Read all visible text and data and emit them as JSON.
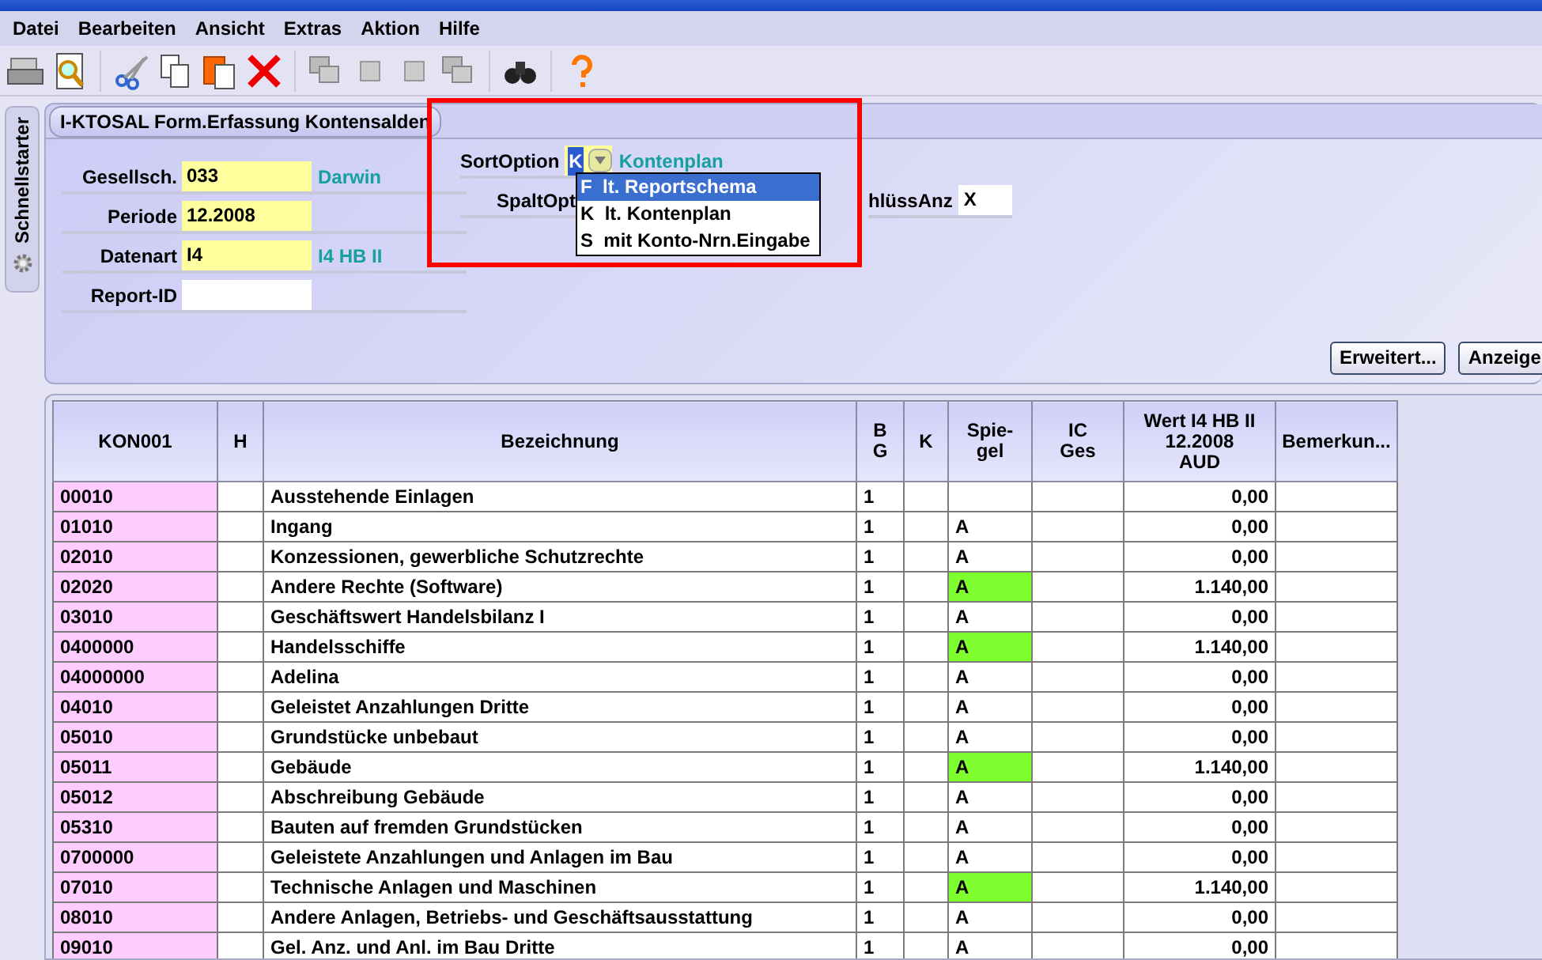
{
  "menu": [
    "Datei",
    "Bearbeiten",
    "Ansicht",
    "Extras",
    "Aktion",
    "Hilfe"
  ],
  "sidebar_tab": "Schnellstarter",
  "form_tab": "I-KTOSAL Form.Erfassung Kontensalden",
  "fields": [
    {
      "label": "Gesellsch.",
      "value": "033",
      "required": true,
      "info": "Darwin"
    },
    {
      "label": "Periode",
      "value": "12.2008",
      "required": true
    },
    {
      "label": "Datenart",
      "value": "I4",
      "required": true,
      "info": "I4 HB II"
    },
    {
      "label": "Report-ID",
      "required": false
    }
  ],
  "sort_option": {
    "label": "SortOption",
    "value": "K",
    "info": "Kontenplan"
  },
  "spalt_opt": {
    "label": "SpaltOpt"
  },
  "schluess_anz": {
    "label": "hlüssAnz",
    "value": "X"
  },
  "dropdown": [
    {
      "code": "F",
      "label": "lt. Reportschema",
      "selected": true
    },
    {
      "code": "K",
      "label": "lt. Kontenplan",
      "selected": false
    },
    {
      "code": "S",
      "label": "mit Konto-Nrn.Eingabe",
      "selected": false
    }
  ],
  "buttons": [
    "Erweitert...",
    "Anzeige"
  ],
  "table": {
    "columns": [
      "KON001",
      "H",
      "Bezeichnung",
      "B\nG",
      "K",
      "Spie-\ngel",
      "IC\nGes",
      "Wert I4 HB II\n12.2008\nAUD",
      "Bemerkun..."
    ],
    "rows": [
      {
        "code": "00010",
        "name": "Ausstehende Einlagen",
        "bg": "1",
        "wert": "0,00",
        "highlighted": false
      },
      {
        "code": "01010",
        "name": "Ingang",
        "bg": "1",
        "spiegel": "A",
        "wert": "0,00",
        "highlighted": false
      },
      {
        "code": "02010",
        "name": "Konzessionen, gewerbliche Schutzrechte",
        "bg": "1",
        "spiegel": "A",
        "wert": "0,00",
        "highlighted": false
      },
      {
        "code": "02020",
        "name": "Andere Rechte (Software)",
        "bg": "1",
        "spiegel": "A",
        "wert": "1.140,00",
        "highlighted": true
      },
      {
        "code": "03010",
        "name": "Geschäftswert Handelsbilanz I",
        "bg": "1",
        "spiegel": "A",
        "wert": "0,00",
        "highlighted": false
      },
      {
        "code": "0400000",
        "name": "Handelsschiffe",
        "bg": "1",
        "spiegel": "A",
        "wert": "1.140,00",
        "highlighted": true
      },
      {
        "code": "04000000",
        "name": "Adelina",
        "bg": "1",
        "spiegel": "A",
        "wert": "0,00",
        "highlighted": false
      },
      {
        "code": "04010",
        "name": "Geleistet Anzahlungen Dritte",
        "bg": "1",
        "spiegel": "A",
        "wert": "0,00",
        "highlighted": false
      },
      {
        "code": "05010",
        "name": "Grundstücke unbebaut",
        "bg": "1",
        "spiegel": "A",
        "wert": "0,00",
        "highlighted": false
      },
      {
        "code": "05011",
        "name": "Gebäude",
        "bg": "1",
        "spiegel": "A",
        "wert": "1.140,00",
        "highlighted": true
      },
      {
        "code": "05012",
        "name": "Abschreibung Gebäude",
        "bg": "1",
        "spiegel": "A",
        "wert": "0,00",
        "highlighted": false
      },
      {
        "code": "05310",
        "name": "Bauten auf fremden Grundstücken",
        "bg": "1",
        "spiegel": "A",
        "wert": "0,00",
        "highlighted": false
      },
      {
        "code": "0700000",
        "name": "Geleistete Anzahlungen und Anlagen im Bau",
        "bg": "1",
        "spiegel": "A",
        "wert": "0,00",
        "highlighted": false
      },
      {
        "code": "07010",
        "name": "Technische Anlagen und Maschinen",
        "bg": "1",
        "spiegel": "A",
        "wert": "1.140,00",
        "highlighted": true
      },
      {
        "code": "08010",
        "name": "Andere Anlagen, Betriebs- und Geschäftsausstattung",
        "bg": "1",
        "spiegel": "A",
        "wert": "0,00",
        "highlighted": false
      },
      {
        "code": "09010",
        "name": "Gel. Anz. und Anl. im Bau Dritte",
        "bg": "1",
        "spiegel": "A",
        "wert": "0,00",
        "highlighted": false
      }
    ]
  }
}
